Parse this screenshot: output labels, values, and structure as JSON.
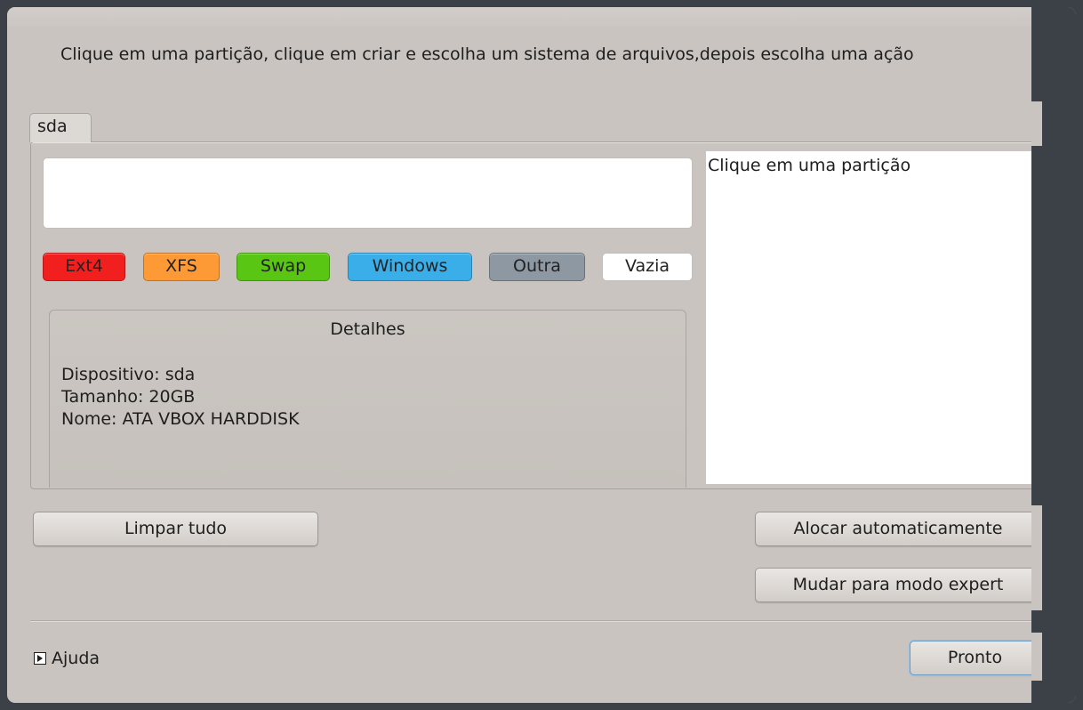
{
  "instruction": "Clique em uma partição, clique em criar e escolha um sistema de arquivos,depois escolha uma ação",
  "disk_tab": "sda",
  "legend": [
    {
      "label": "Ext4",
      "color": "#f21f1f"
    },
    {
      "label": "XFS",
      "color": "#fd9a35"
    },
    {
      "label": "Swap",
      "color": "#58c613"
    },
    {
      "label": "Windows",
      "color": "#3aaee9"
    },
    {
      "label": "Outra",
      "color": "#8d98a3"
    },
    {
      "label": "Vazia",
      "color": "#ffffff"
    }
  ],
  "details": {
    "title": "Detalhes",
    "device": "Dispositivo: sda",
    "size": "Tamanho: 20GB",
    "name": "Nome: ATA VBOX HARDDISK"
  },
  "info_pane": "Clique em uma partição",
  "buttons": {
    "clear_all": "Limpar tudo",
    "auto_allocate": "Alocar automaticamente",
    "expert_mode": "Mudar para modo expert",
    "done": "Pronto"
  },
  "help_label": "Ajuda"
}
